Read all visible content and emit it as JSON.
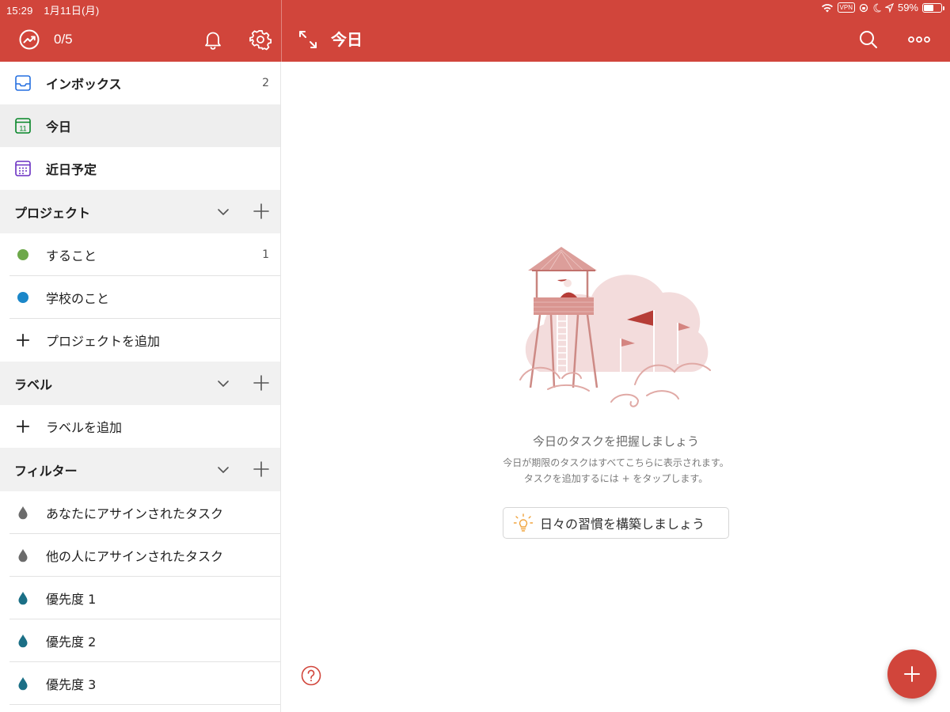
{
  "status_bar": {
    "time": "15:29",
    "date": "1月11日(月)",
    "vpn": "VPN",
    "battery_percent": "59%",
    "battery_level": 0.59
  },
  "header": {
    "karma_count": "0/5",
    "view_title": "今日"
  },
  "sidebar": {
    "nav": [
      {
        "label": "インボックス",
        "count": "2",
        "icon": "inbox-icon"
      },
      {
        "label": "今日",
        "count": "",
        "icon": "calendar-today-icon",
        "day": "11"
      },
      {
        "label": "近日予定",
        "count": "",
        "icon": "calendar-upcoming-icon"
      }
    ],
    "projects_header": "プロジェクト",
    "projects": [
      {
        "label": "すること",
        "count": "1",
        "color": "#6da84a"
      },
      {
        "label": "学校のこと",
        "count": "",
        "color": "#1b87c9"
      }
    ],
    "add_project": "プロジェクトを追加",
    "labels_header": "ラベル",
    "add_label": "ラベルを追加",
    "filters_header": "フィルター",
    "filters": [
      {
        "label": "あなたにアサインされたタスク",
        "color": "#6b6b6b"
      },
      {
        "label": "他の人にアサインされたタスク",
        "color": "#6b6b6b"
      },
      {
        "label": "優先度 1",
        "color": "#1b6f86"
      },
      {
        "label": "優先度 2",
        "color": "#1b6f86"
      },
      {
        "label": "優先度 3",
        "color": "#1b6f86"
      }
    ]
  },
  "main": {
    "empty_title": "今日のタスクを把握しましょう",
    "empty_sub1": "今日が期限のタスクはすべてこちらに表示されます。",
    "empty_sub2": "タスクを追加するには + をタップします。",
    "habit_button": "日々の習慣を構築しましょう"
  },
  "colors": {
    "brand": "#d1453b",
    "active_row": "#eeeeee",
    "section_bg": "#f1f1f1"
  }
}
